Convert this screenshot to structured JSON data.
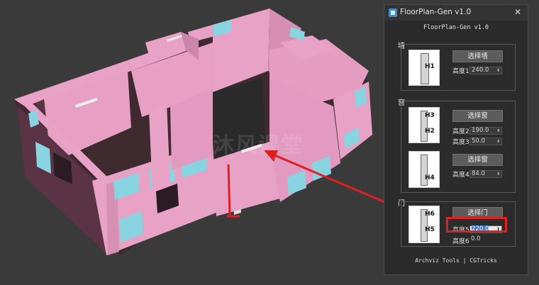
{
  "window": {
    "title": "FloorPlan-Gen v1.0",
    "header": "FloorPlan-Gen v1.0",
    "footer": "Archviz Tools | CGTricks",
    "close_glyph": "✕"
  },
  "viewport": {
    "watermark": "沐风课堂"
  },
  "wall_group": {
    "label": "墙",
    "diagram_label": "H1",
    "button": "选择墙",
    "param_label": "高度1",
    "param_value": "240.0"
  },
  "window_group": {
    "label": "窗",
    "diagram_top_labels": [
      "H3",
      "H2"
    ],
    "diagram_bottom_label": "H4",
    "button_1": "选择窗",
    "button_2": "选择窗",
    "param2_label": "高度2",
    "param2_value": "190.0",
    "param3_label": "高度3",
    "param3_value": "50.0",
    "param4_label": "高度4",
    "param4_value": "84.0"
  },
  "door_group": {
    "label": "门",
    "diagram_labels": [
      "H6",
      "H5"
    ],
    "button": "选择门",
    "param5_label": "高度5",
    "param5_value": "220.0",
    "param6_label": "高度6",
    "param6_value": "0.0"
  },
  "colors": {
    "wall_pink": "#e8a2c6",
    "wall_dark": "#4a2a35",
    "window_cyan": "#88d4e0",
    "annotation_red": "#e02020",
    "panel_bg": "#2b2b2b"
  },
  "icons": [
    "app-icon",
    "close-icon",
    "spinner-arrows-icon",
    "arrow-annotation"
  ]
}
